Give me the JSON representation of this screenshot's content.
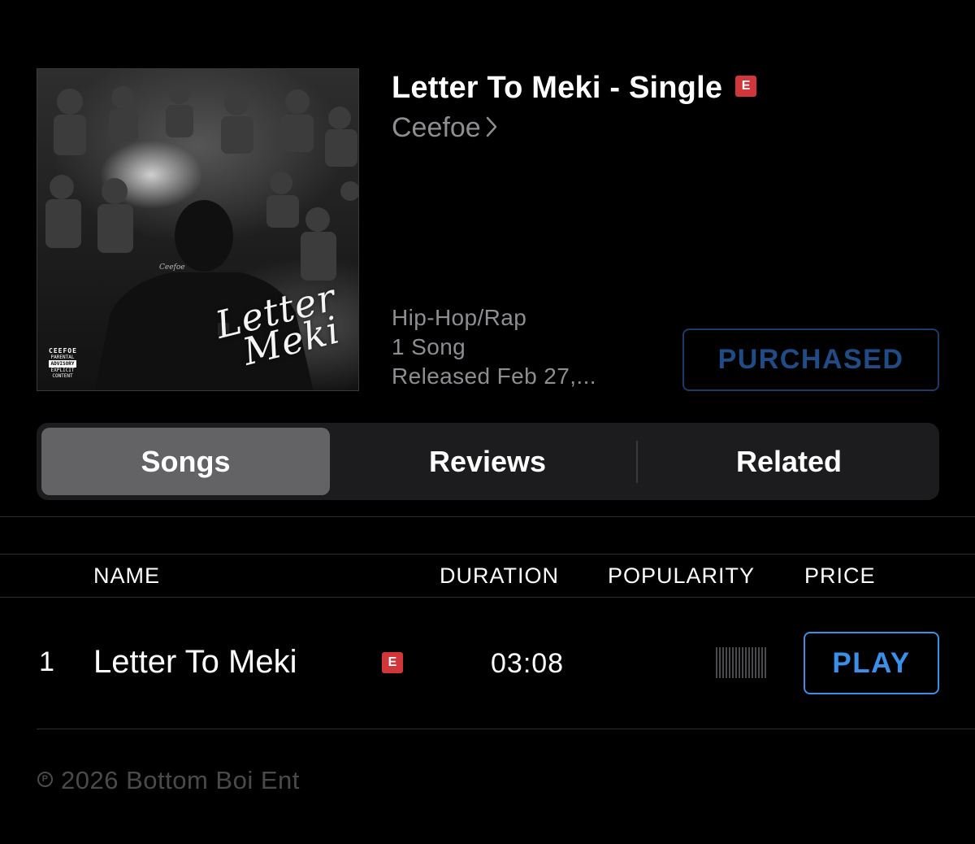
{
  "album": {
    "title": "Letter To Meki - Single",
    "explicit_label": "E",
    "artist": "Ceefoe",
    "genre": "Hip-Hop/Rap",
    "song_count": "1 Song",
    "released": "Released Feb 27,...",
    "purchase_label": "PURCHASED",
    "art": {
      "script_top": "Letter",
      "script_bottom": "Meki",
      "advisory_artist": "CEEFOE",
      "advisory_top": "PARENTAL",
      "advisory_mid": "ADVISORY",
      "advisory_bottom": "EXPLICIT CONTENT"
    }
  },
  "tabs": {
    "songs": "Songs",
    "reviews": "Reviews",
    "related": "Related",
    "selected": "Songs"
  },
  "table": {
    "headers": {
      "name": "NAME",
      "duration": "DURATION",
      "popularity": "POPULARITY",
      "price": "PRICE"
    },
    "rows": [
      {
        "number": "1",
        "title": "Letter To Meki",
        "explicit": "E",
        "duration": "03:08",
        "action": "PLAY"
      }
    ]
  },
  "copyright": {
    "symbol": "P",
    "text": "2026 Bottom Boi Ent"
  },
  "colors": {
    "background": "#000000",
    "explicit_badge": "#d1363a",
    "play_accent": "#3a8fe8",
    "purchased_accent": "#1f4b86",
    "secondary_text": "#8d8d92"
  },
  "icons": {
    "artist_chevron": "chevron-right-icon",
    "popularity": "popularity-bars-icon"
  }
}
